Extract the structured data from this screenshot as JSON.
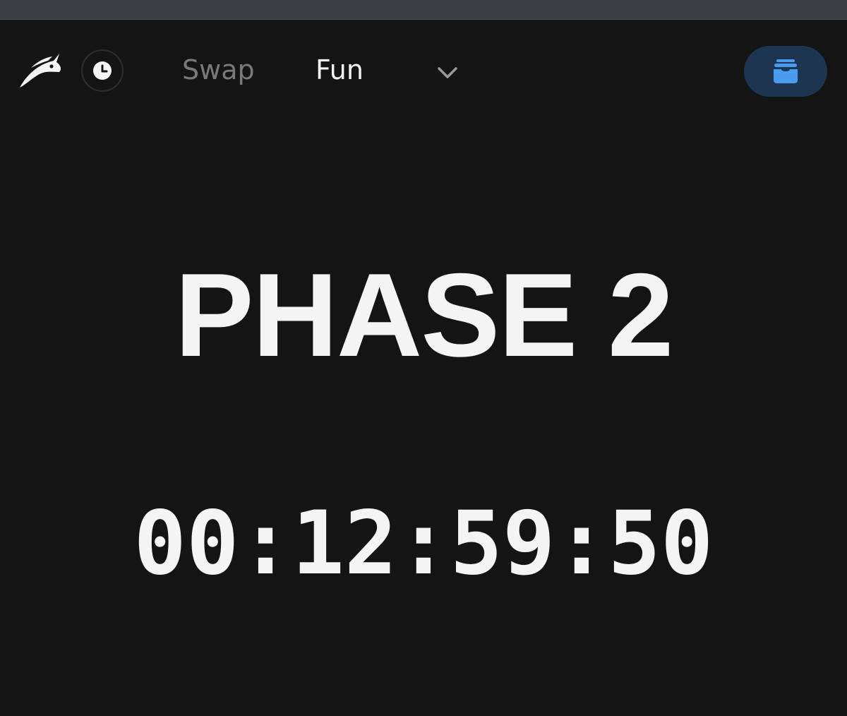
{
  "nav": {
    "logo_icon": "jupiter-rabbit-logo-icon",
    "history_icon": "clock-icon",
    "items": [
      {
        "label": "Swap"
      },
      {
        "label": "Fun"
      }
    ],
    "more_icon": "chevron-down-icon",
    "portfolio_icon": "archive-box-icon"
  },
  "main": {
    "phase_title": "PHASE 2",
    "countdown": "00:12:59:50"
  },
  "colors": {
    "background": "#141414",
    "browser_bar": "#3b3f43",
    "text_primary": "#f4f4f4",
    "text_muted": "#7a7a7a",
    "accent_button_bg": "#1d3550",
    "accent_icon": "#4a9cf0"
  }
}
